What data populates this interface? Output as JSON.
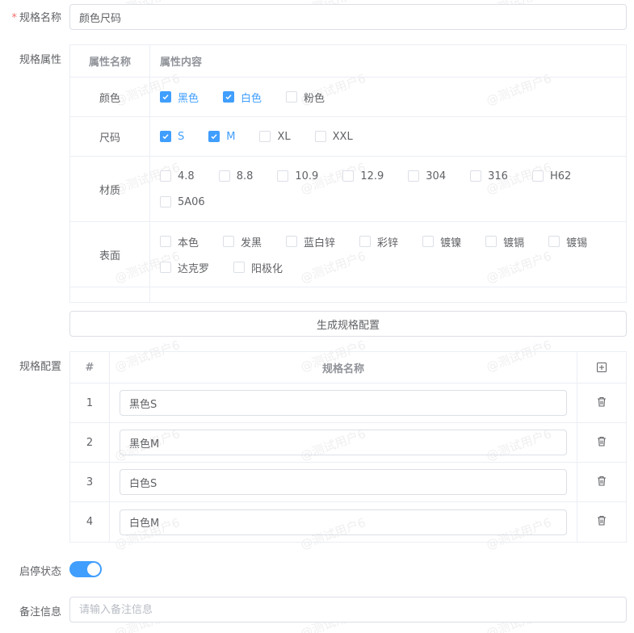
{
  "form": {
    "spec_name_label": "规格名称",
    "spec_name_required": "*",
    "spec_name_value": "颜色尺码",
    "spec_attr_label": "规格属性",
    "spec_config_label": "规格配置",
    "status_label": "启停状态",
    "status_on": true,
    "remark_label": "备注信息",
    "remark_placeholder": "请输入备注信息"
  },
  "attr_table": {
    "head_name": "属性名称",
    "head_content": "属性内容",
    "rows": [
      {
        "name": "颜色",
        "options": [
          {
            "label": "黑色",
            "checked": true
          },
          {
            "label": "白色",
            "checked": true
          },
          {
            "label": "粉色",
            "checked": false
          }
        ]
      },
      {
        "name": "尺码",
        "options": [
          {
            "label": "S",
            "checked": true
          },
          {
            "label": "M",
            "checked": true
          },
          {
            "label": "XL",
            "checked": false
          },
          {
            "label": "XXL",
            "checked": false
          }
        ]
      },
      {
        "name": "材质",
        "options": [
          {
            "label": "4.8",
            "checked": false
          },
          {
            "label": "8.8",
            "checked": false
          },
          {
            "label": "10.9",
            "checked": false
          },
          {
            "label": "12.9",
            "checked": false
          },
          {
            "label": "304",
            "checked": false
          },
          {
            "label": "316",
            "checked": false
          },
          {
            "label": "H62",
            "checked": false
          },
          {
            "label": "5A06",
            "checked": false
          }
        ]
      },
      {
        "name": "表面",
        "options": [
          {
            "label": "本色",
            "checked": false
          },
          {
            "label": "发黑",
            "checked": false
          },
          {
            "label": "蓝白锌",
            "checked": false
          },
          {
            "label": "彩锌",
            "checked": false
          },
          {
            "label": "镀镍",
            "checked": false
          },
          {
            "label": "镀镉",
            "checked": false
          },
          {
            "label": "镀锡",
            "checked": false
          },
          {
            "label": "达克罗",
            "checked": false
          },
          {
            "label": "阳极化",
            "checked": false
          }
        ]
      }
    ]
  },
  "generate_button": "生成规格配置",
  "config_table": {
    "head_index": "#",
    "head_name": "规格名称",
    "add_icon": "plus-square-icon",
    "delete_icon": "trash-icon",
    "rows": [
      {
        "index": "1",
        "name": "黑色S"
      },
      {
        "index": "2",
        "name": "黑色M"
      },
      {
        "index": "3",
        "name": "白色S"
      },
      {
        "index": "4",
        "name": "白色M"
      }
    ]
  },
  "watermark": "@测试用户6",
  "colors": {
    "primary": "#409eff",
    "border": "#dcdfe6",
    "danger": "#f56c6c"
  }
}
